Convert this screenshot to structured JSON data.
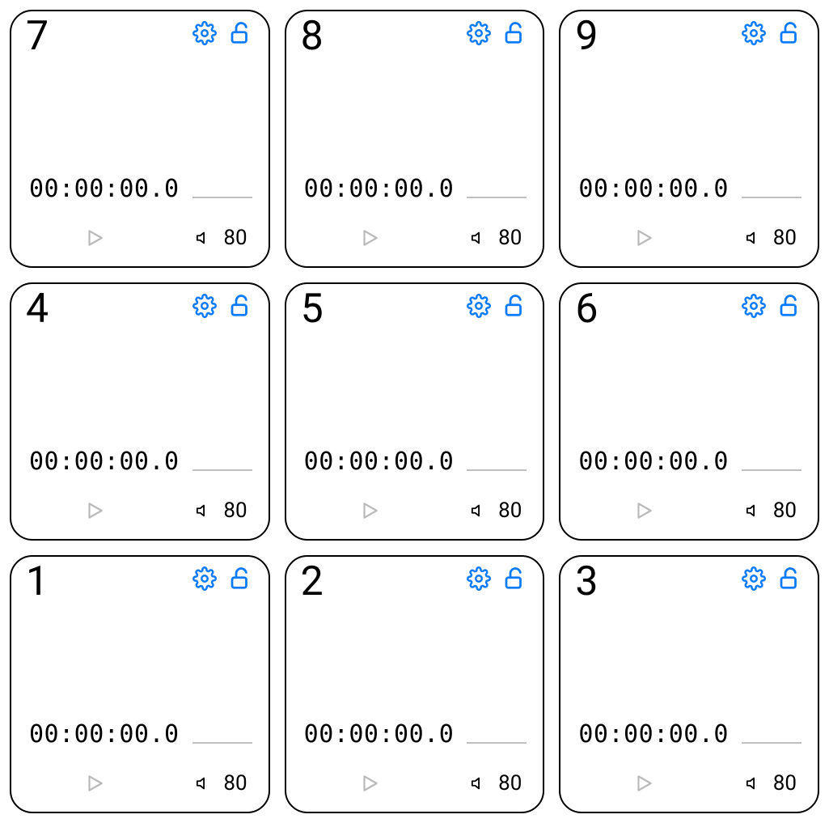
{
  "accent_color": "#0a7aff",
  "cards": [
    {
      "number": "7",
      "time": "00:00:00.0",
      "volume": "80"
    },
    {
      "number": "8",
      "time": "00:00:00.0",
      "volume": "80"
    },
    {
      "number": "9",
      "time": "00:00:00.0",
      "volume": "80"
    },
    {
      "number": "4",
      "time": "00:00:00.0",
      "volume": "80"
    },
    {
      "number": "5",
      "time": "00:00:00.0",
      "volume": "80"
    },
    {
      "number": "6",
      "time": "00:00:00.0",
      "volume": "80"
    },
    {
      "number": "1",
      "time": "00:00:00.0",
      "volume": "80"
    },
    {
      "number": "2",
      "time": "00:00:00.0",
      "volume": "80"
    },
    {
      "number": "3",
      "time": "00:00:00.0",
      "volume": "80"
    }
  ],
  "icons": {
    "settings": "gear-icon",
    "lock": "unlock-icon",
    "play": "play-icon",
    "volume": "speaker-icon"
  }
}
